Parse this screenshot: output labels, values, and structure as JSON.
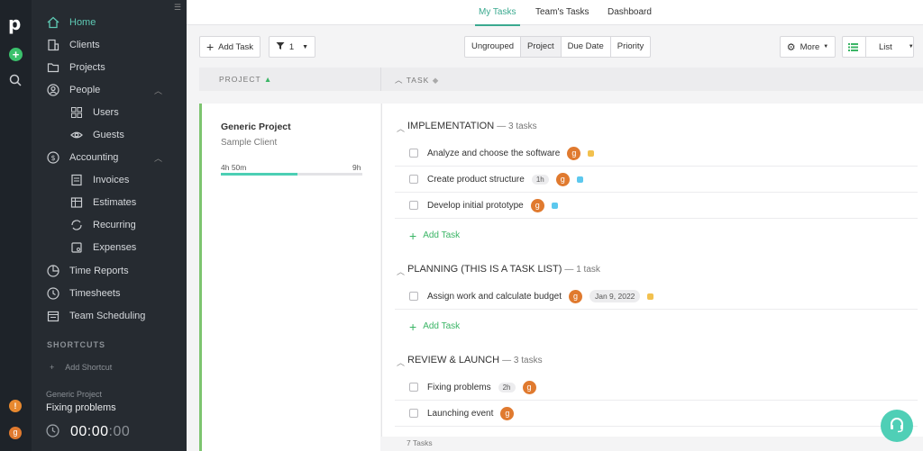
{
  "rail": {
    "logo": "p",
    "alert": "!",
    "user_initial": "g"
  },
  "sidebar": {
    "items": [
      {
        "label": "Home"
      },
      {
        "label": "Clients"
      },
      {
        "label": "Projects"
      },
      {
        "label": "People"
      },
      {
        "label": "Users"
      },
      {
        "label": "Guests"
      },
      {
        "label": "Accounting"
      },
      {
        "label": "Invoices"
      },
      {
        "label": "Estimates"
      },
      {
        "label": "Recurring"
      },
      {
        "label": "Expenses"
      },
      {
        "label": "Time Reports"
      },
      {
        "label": "Timesheets"
      },
      {
        "label": "Team Scheduling"
      }
    ],
    "shortcuts_heading": "SHORTCUTS",
    "add_shortcut": "Add Shortcut",
    "timer": {
      "project": "Generic Project",
      "task": "Fixing problems",
      "time_main": "00:00",
      "time_sec": ":00"
    }
  },
  "topbar": {
    "tabs": [
      "My Tasks",
      "Team's Tasks",
      "Dashboard"
    ]
  },
  "toolbar": {
    "add_task": "Add Task",
    "filter_count": "1",
    "grouping": [
      "Ungrouped",
      "Project",
      "Due Date",
      "Priority"
    ],
    "more": "More",
    "view": "List"
  },
  "columns": {
    "project": "PROJECT",
    "task": "TASK"
  },
  "project": {
    "name": "Generic Project",
    "client": "Sample Client",
    "time_logged": "4h 50m",
    "budget": "9h",
    "progress": 0.54
  },
  "task_lists": [
    {
      "title": "IMPLEMENTATION",
      "count": "— 3 tasks",
      "tasks": [
        {
          "name": "Analyze and choose the software",
          "avatar": "g",
          "tag_color": "#f2c14e"
        },
        {
          "name": "Create product structure",
          "estimate": "1h",
          "avatar": "g",
          "tag_color": "#5cc8ee"
        },
        {
          "name": "Develop initial prototype",
          "avatar": "g",
          "tag_color": "#5cc8ee"
        }
      ]
    },
    {
      "title": "PLANNING (THIS IS A TASK LIST)",
      "count": "— 1 task",
      "tasks": [
        {
          "name": "Assign work and calculate budget",
          "avatar": "g",
          "due": "Jan 9, 2022",
          "tag_color": "#f2c14e"
        }
      ]
    },
    {
      "title": "REVIEW & LAUNCH",
      "count": "— 3 tasks",
      "tasks": [
        {
          "name": "Fixing problems",
          "estimate": "2h",
          "avatar": "g"
        },
        {
          "name": "Launching event",
          "avatar": "g"
        }
      ]
    }
  ],
  "add_task_link": "Add Task",
  "footer": {
    "total": "7 Tasks"
  },
  "colors": {
    "accent": "#3aa98f",
    "project_border": "#7dc46f",
    "progress": "#4ccfb4",
    "add_green": "#3bb566",
    "avatar": "#e07a2f"
  }
}
